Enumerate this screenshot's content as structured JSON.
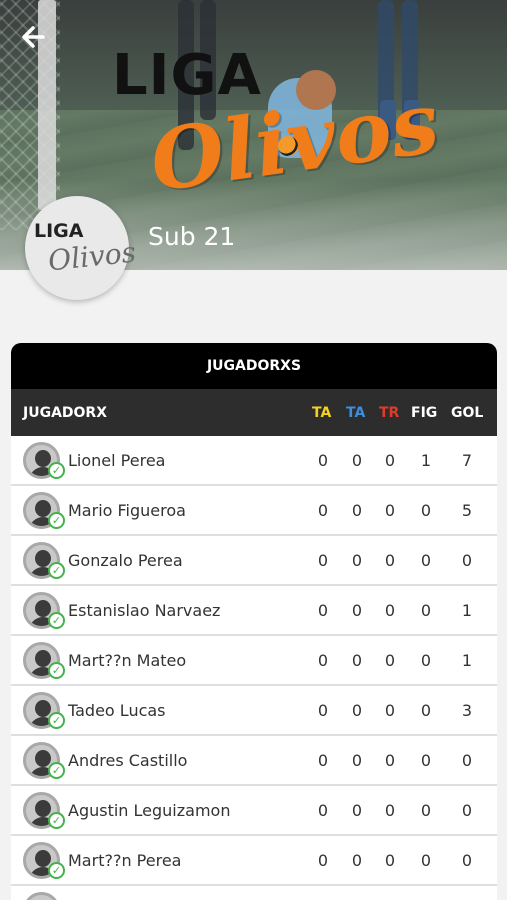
{
  "header": {
    "logo_top": "LIGA",
    "logo_bottom": "Olivos",
    "badge_top": "LIGA",
    "badge_bottom": "Olivos",
    "category": "Sub 21"
  },
  "colors": {
    "accent_orange": "#f07c1a",
    "ta_yellow": "#f5d21e",
    "ta_blue": "#3a8fe0",
    "tr_red": "#e23a2a",
    "check_green": "#44b24a"
  },
  "table": {
    "title": "JUGADORXS",
    "columns": [
      "JUGADORX",
      "TA",
      "TA",
      "TR",
      "FIG",
      "GOL"
    ],
    "rows": [
      {
        "name": "Lionel Perea",
        "stats": [
          "0",
          "0",
          "0",
          "1",
          "7"
        ]
      },
      {
        "name": "Mario Figueroa",
        "stats": [
          "0",
          "0",
          "0",
          "0",
          "5"
        ]
      },
      {
        "name": "Gonzalo Perea",
        "stats": [
          "0",
          "0",
          "0",
          "0",
          "0"
        ]
      },
      {
        "name": "Estanislao Narvaez",
        "stats": [
          "0",
          "0",
          "0",
          "0",
          "1"
        ]
      },
      {
        "name": "Mart??n Mateo",
        "stats": [
          "0",
          "0",
          "0",
          "0",
          "1"
        ]
      },
      {
        "name": "Tadeo Lucas",
        "stats": [
          "0",
          "0",
          "0",
          "0",
          "3"
        ]
      },
      {
        "name": "Andres Castillo",
        "stats": [
          "0",
          "0",
          "0",
          "0",
          "0"
        ]
      },
      {
        "name": "Agustin Leguizamon",
        "stats": [
          "0",
          "0",
          "0",
          "0",
          "0"
        ]
      },
      {
        "name": "Mart??n Perea",
        "stats": [
          "0",
          "0",
          "0",
          "0",
          "0"
        ]
      },
      {
        "name": "",
        "stats": [
          "",
          "",
          "",
          "",
          ""
        ]
      }
    ]
  }
}
